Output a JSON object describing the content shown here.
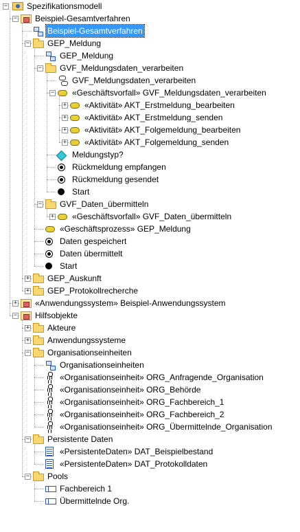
{
  "tree": {
    "nodes": [
      {
        "label": "Spezifikationsmodell",
        "icon": "model-root-icon",
        "toggle": "minus"
      },
      {
        "label": "Beispiel-Gesamtverfahren",
        "icon": "package-diagram-icon",
        "toggle": "minus"
      },
      {
        "label": "Beispiel-Gesamtverfahren",
        "icon": "diagram-icon",
        "toggle": "",
        "selected": true
      },
      {
        "label": "GEP_Meldung",
        "icon": "folder-icon",
        "toggle": "minus"
      },
      {
        "label": "GEP_Meldung",
        "icon": "diagram-icon",
        "toggle": ""
      },
      {
        "label": "GVF_Meldungsdaten_verarbeiten",
        "icon": "folder-icon",
        "toggle": "minus"
      },
      {
        "label": "GVF_Meldungsdaten_verarbeiten",
        "icon": "activity-diagram-icon",
        "toggle": ""
      },
      {
        "label": "«Geschäftsvorfall» GVF_Meldungsdaten_verarbeiten",
        "icon": "activity-icon",
        "toggle": "minus"
      },
      {
        "label": "«Aktivität» AKT_Erstmeldung_bearbeiten",
        "icon": "activity-icon",
        "toggle": "plus"
      },
      {
        "label": "«Aktivität» AKT_Erstmeldung_senden",
        "icon": "activity-icon",
        "toggle": "plus"
      },
      {
        "label": "«Aktivität» AKT_Folgemeldung_bearbeiten",
        "icon": "activity-icon",
        "toggle": "plus"
      },
      {
        "label": "«Aktivität» AKT_Folgemeldung_senden",
        "icon": "activity-icon",
        "toggle": "plus"
      },
      {
        "label": "Meldungstyp?",
        "icon": "decision-icon",
        "toggle": ""
      },
      {
        "label": "Rückmeldung empfangen",
        "icon": "final-node-icon",
        "toggle": ""
      },
      {
        "label": "Rückmeldung gesendet",
        "icon": "final-node-icon",
        "toggle": ""
      },
      {
        "label": "Start",
        "icon": "initial-node-icon",
        "toggle": ""
      },
      {
        "label": "GVF_Daten_übermitteln",
        "icon": "folder-icon",
        "toggle": "minus"
      },
      {
        "label": "«Geschäftsvorfall» GVF_Daten_übermitteln",
        "icon": "activity-icon",
        "toggle": "plus"
      },
      {
        "label": "«Geschäftsprozess» GEP_Meldung",
        "icon": "activity-icon",
        "toggle": ""
      },
      {
        "label": "Daten gespeichert",
        "icon": "final-node-icon",
        "toggle": ""
      },
      {
        "label": "Daten übermittelt",
        "icon": "final-node-icon",
        "toggle": ""
      },
      {
        "label": "Start",
        "icon": "initial-node-icon",
        "toggle": ""
      },
      {
        "label": "GEP_Auskunft",
        "icon": "folder-icon",
        "toggle": "plus"
      },
      {
        "label": "GEP_Protokollrecherche",
        "icon": "folder-icon",
        "toggle": "plus"
      },
      {
        "label": "«Anwendungssystem» Beispiel-Anwendungssystem",
        "icon": "package-diagram-icon",
        "toggle": "plus"
      },
      {
        "label": "Hilfsobjekte",
        "icon": "package-diagram-icon",
        "toggle": "minus"
      },
      {
        "label": "Akteure",
        "icon": "folder-icon",
        "toggle": "plus"
      },
      {
        "label": "Anwendungssysteme",
        "icon": "folder-icon",
        "toggle": "plus"
      },
      {
        "label": "Organisationseinheiten",
        "icon": "folder-icon",
        "toggle": "minus"
      },
      {
        "label": "Organisationseinheiten",
        "icon": "diagram-icon",
        "toggle": ""
      },
      {
        "label": "«Organisationseinheit» ORG_Anfragende_Organisation",
        "icon": "actor-icon",
        "toggle": ""
      },
      {
        "label": "«Organisationseinheit» ORG_Behörde",
        "icon": "actor-icon",
        "toggle": ""
      },
      {
        "label": "«Organisationseinheit» ORG_Fachbereich_1",
        "icon": "actor-icon",
        "toggle": ""
      },
      {
        "label": "«Organisationseinheit» ORG_Fachbereich_2",
        "icon": "actor-icon",
        "toggle": ""
      },
      {
        "label": "«Organisationseinheit» ORG_Übermittelnde_Organisation",
        "icon": "actor-icon",
        "toggle": ""
      },
      {
        "label": "Persistente Daten",
        "icon": "folder-icon",
        "toggle": "minus"
      },
      {
        "label": "«PersistenteDaten» DAT_Beispielbestand",
        "icon": "data-icon",
        "toggle": ""
      },
      {
        "label": "«PersistenteDaten» DAT_Protokolldaten",
        "icon": "data-icon",
        "toggle": ""
      },
      {
        "label": "Pools",
        "icon": "folder-icon",
        "toggle": "minus"
      },
      {
        "label": "Fachbereich 1",
        "icon": "pool-icon",
        "toggle": ""
      },
      {
        "label": "Übermittelnde Org.",
        "icon": "pool-icon",
        "toggle": ""
      }
    ]
  }
}
